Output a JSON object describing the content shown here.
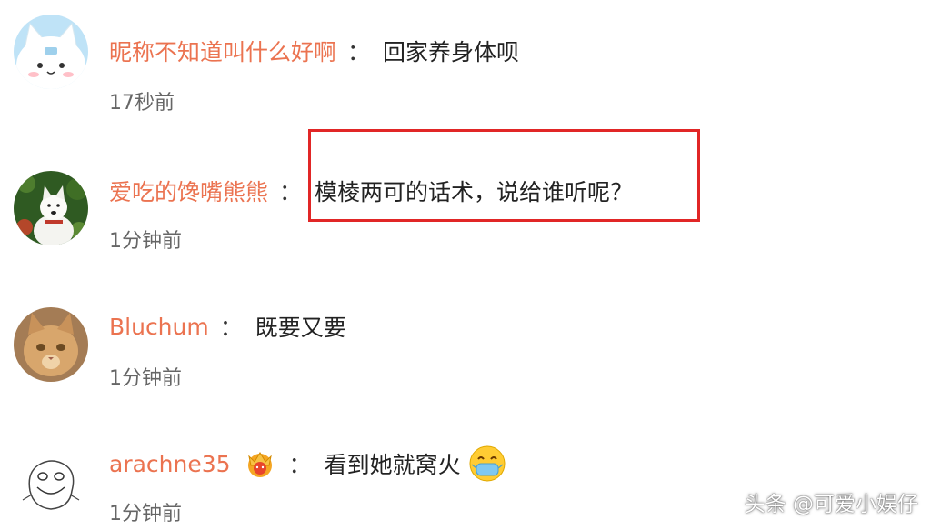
{
  "comments": [
    {
      "username": "昵称不知道叫什么好啊",
      "separator": "：",
      "text": "回家养身体呗",
      "time": "17秒前",
      "avatar": "cartoon-cat-avatar"
    },
    {
      "username": "爱吃的馋嘴熊熊",
      "separator": "：",
      "text": "模棱两可的话术，说给谁听呢？",
      "time": "1分钟前",
      "avatar": "white-dog-photo-avatar",
      "highlighted": true
    },
    {
      "username": "Bluchum",
      "separator": "：",
      "text": "既要又要",
      "time": "1分钟前",
      "avatar": "orange-cat-photo-avatar"
    },
    {
      "username": "arachne35",
      "separator": "：",
      "text": "看到她就窝火",
      "time": "1分钟前",
      "avatar": "doodle-face-avatar",
      "badge": "crown-badge-icon",
      "emoji": "mask-smile-emoji"
    }
  ],
  "colors": {
    "username": "#eb7350",
    "highlight": "#e12626",
    "time": "#666666"
  },
  "watermark": "头条 @可爱小娱仔"
}
